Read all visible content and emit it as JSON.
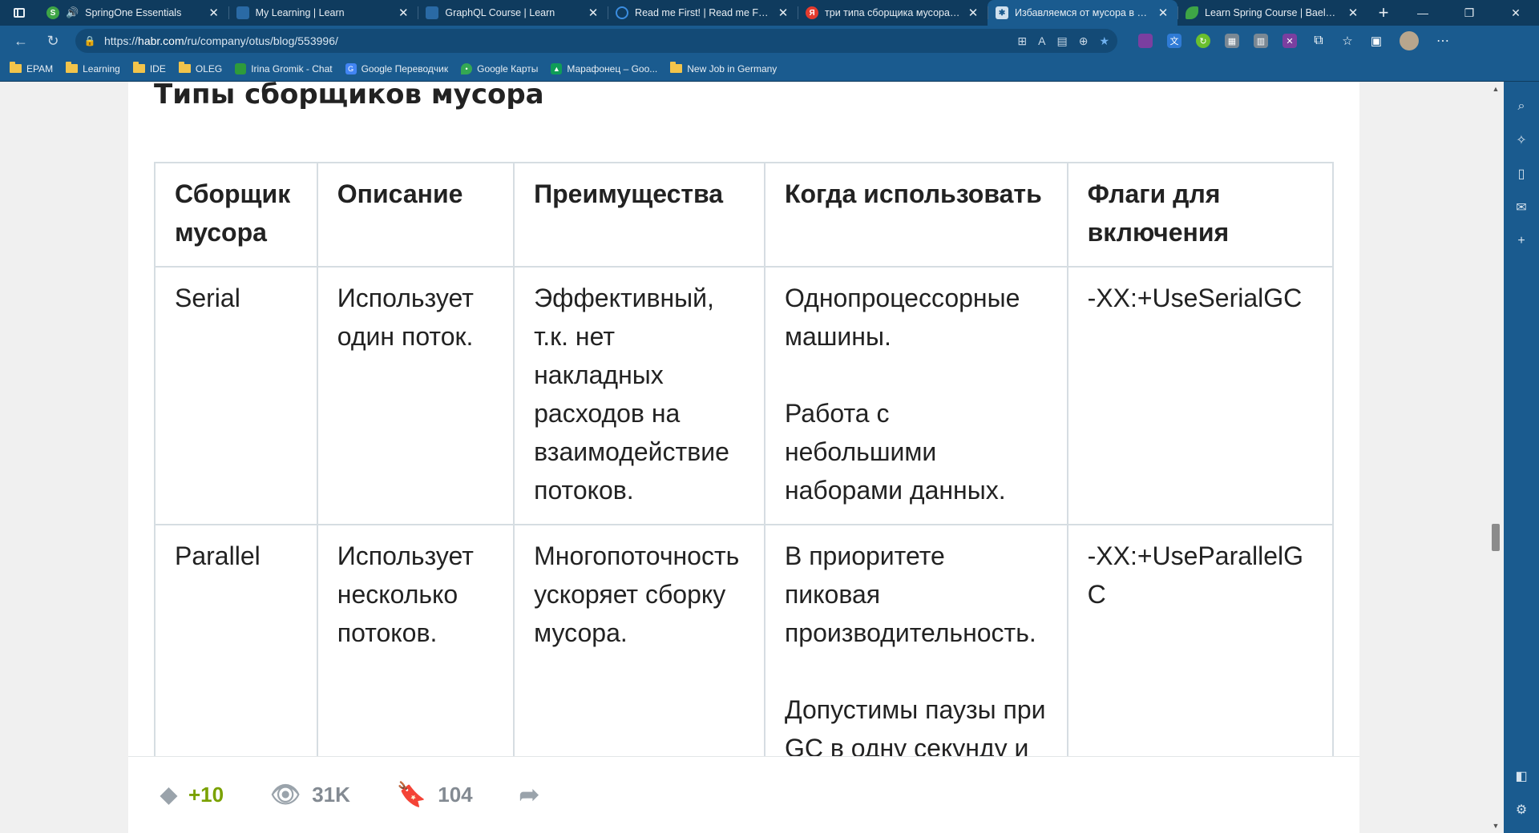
{
  "browser": {
    "tabs": [
      {
        "title": "SpringOne Essentials",
        "fav_color": "#3ea546",
        "fav_text": "S",
        "icon": "spring-icon",
        "sound": true
      },
      {
        "title": "My Learning | Learn",
        "fav_color": "#2a6aa5",
        "fav_text": "",
        "icon": "learn-icon"
      },
      {
        "title": "GraphQL Course | Learn",
        "fav_color": "#2a6aa5",
        "fav_text": "",
        "icon": "learn-icon"
      },
      {
        "title": "Read me First! | Read me First! | A",
        "fav_color": "#3b8de0",
        "fav_text": "",
        "icon": "circle-icon"
      },
      {
        "title": "три типа сборщика мусора в ja",
        "fav_color": "#e33b2e",
        "fav_text": "Я",
        "icon": "yandex-icon"
      },
      {
        "title": "Избавляемся от мусора в Java",
        "fav_color": "#5e8fbf",
        "fav_text": "",
        "icon": "habr-icon",
        "active": true
      },
      {
        "title": "Learn Spring Course | Baeldung",
        "fav_color": "#3ea546",
        "fav_text": "",
        "icon": "leaf-icon"
      }
    ],
    "url_prefix": "https://",
    "url_host": "habr.com",
    "url_path": "/ru/company/otus/blog/553996/",
    "bookmarks": [
      {
        "label": "EPAM",
        "type": "folder"
      },
      {
        "label": "Learning",
        "type": "folder"
      },
      {
        "label": "IDE",
        "type": "folder"
      },
      {
        "label": "OLEG",
        "type": "folder"
      },
      {
        "label": "Irina Gromik - Chat",
        "type": "site",
        "color": "#2e9b3b"
      },
      {
        "label": "Google Переводчик",
        "type": "site",
        "color": "#4285f4"
      },
      {
        "label": "Google Карты",
        "type": "site",
        "color": "#34a853"
      },
      {
        "label": "Марафонец – Goo...",
        "type": "site",
        "color": "#0f9d58"
      },
      {
        "label": "New Job in Germany",
        "type": "folder"
      }
    ]
  },
  "article": {
    "heading": "Типы сборщиков мусора",
    "table": {
      "headers": [
        "Сборщик мусора",
        "Описание",
        "Преимущества",
        "Когда использовать",
        "Флаги для включения"
      ],
      "rows": [
        {
          "collector": "Serial",
          "description": "Использует один поток.",
          "advantages": "Эффективный, т.к. нет накладных расходов на взаимодействие потоков.",
          "when_1": "Однопроцессорные машины.",
          "when_2": "Работа с небольшими наборами данных.",
          "flags": "-XX:+UseSerialGC"
        },
        {
          "collector": "Parallel",
          "description": "Использует несколько потоков.",
          "advantages": "Многопоточность ускоряет сборку мусора.",
          "when_1": "В приоритете пиковая производительность.",
          "when_2": "Допустимы паузы при GC в одну секунду и",
          "flags": "-XX:+UseParallelGC"
        }
      ]
    },
    "footer": {
      "rating": "+10",
      "views": "31K",
      "bookmarks": "104"
    }
  }
}
